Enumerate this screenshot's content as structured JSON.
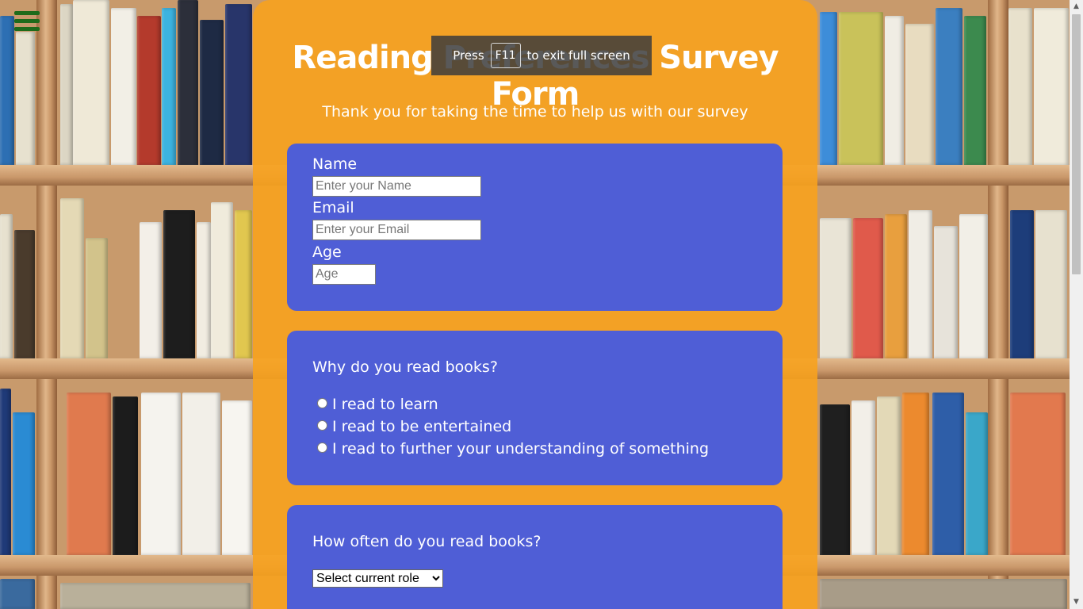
{
  "header": {
    "title": "Reading Preferences Survey Form",
    "subtitle": "Thank you for taking the time to help us with our survey"
  },
  "personal": {
    "name_label": "Name",
    "name_placeholder": "Enter your Name",
    "email_label": "Email",
    "email_placeholder": "Enter your Email",
    "age_label": "Age",
    "age_placeholder": "Age"
  },
  "reasons": {
    "question": "Why do you read books?",
    "options": [
      "I read to learn",
      "I read to be entertained",
      "I read to further your understanding of something"
    ]
  },
  "frequency": {
    "question": "How often do you read books?",
    "selected": "Select current role"
  },
  "fullscreen_toast": {
    "prefix": "Press",
    "key": "F11",
    "suffix": "to exit full screen"
  },
  "colors": {
    "panel": "#F7A21E",
    "card": "#4F5ED6",
    "menu_icon": "#1F6B1A"
  },
  "icons": {
    "menu": "hamburger-icon"
  }
}
